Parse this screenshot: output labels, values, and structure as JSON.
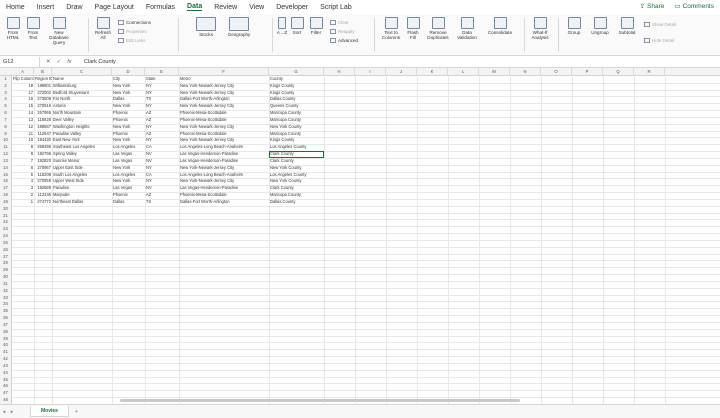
{
  "menu": {
    "tabs": [
      "Home",
      "Insert",
      "Draw",
      "Page Layout",
      "Formulas",
      "Data",
      "Review",
      "View",
      "Developer",
      "Script Lab"
    ],
    "active": "Data",
    "share_label": "Share",
    "comments_label": "Comments"
  },
  "ribbon": {
    "from_html": "From HTML",
    "from_text": "From Text",
    "new_db_query": "New Database Query",
    "refresh_all": "Refresh All",
    "connections": "Connections",
    "properties": "Properties",
    "edit_links": "Edit Links",
    "stocks": "Stocks",
    "geography": "Geography",
    "sort_az": "A→Z",
    "sort": "Sort",
    "filter": "Filter",
    "clear": "Clear",
    "reapply": "Reapply",
    "advanced": "Advanced",
    "text_to_columns": "Text to Columns",
    "flash_fill": "Flash Fill",
    "remove_duplicates": "Remove Duplicates",
    "data_validation": "Data Validation",
    "consolidate": "Consolidate",
    "what_if": "What-If Analysis",
    "group": "Group",
    "ungroup": "Ungroup",
    "subtotal": "Subtotal",
    "show_detail": "Show Detail",
    "hide_detail": "Hide Detail"
  },
  "formula_bar": {
    "name_box": "G12",
    "fx": "fx",
    "value": "Clark County"
  },
  "columns": [
    "A",
    "B",
    "C",
    "D",
    "E",
    "F",
    "G",
    "H",
    "I",
    "J",
    "K",
    "L",
    "M",
    "N",
    "O",
    "P",
    "Q",
    "R"
  ],
  "rows": [
    "1",
    "2",
    "3",
    "4",
    "5",
    "6",
    "7",
    "8",
    "9",
    "10",
    "11",
    "12",
    "13",
    "14",
    "15",
    "16",
    "17",
    "18",
    "19",
    "20",
    "21",
    "22",
    "23",
    "24",
    "25",
    "26",
    "27",
    "28",
    "29",
    "30",
    "31",
    "32",
    "33",
    "34",
    "35",
    "36",
    "37",
    "38",
    "39",
    "40",
    "41",
    "42",
    "43",
    "44",
    "45",
    "46",
    "47",
    "48"
  ],
  "headers": [
    "Flip Column",
    "Region ID",
    "Name",
    "City",
    "State",
    "Metro",
    "County"
  ],
  "table": [
    [
      "18",
      "199801",
      "Williamsburg",
      "New York",
      "NY",
      "New York-Newark-Jersey City",
      "Kings County"
    ],
    [
      "17",
      "272002",
      "Bedford Stuyvesant",
      "New York",
      "NY",
      "New York-Newark-Jersey City",
      "Kings County"
    ],
    [
      "16",
      "273608",
      "Far North",
      "Dallas",
      "TX",
      "Dallas-Fort Worth-Arlington",
      "Dallas County"
    ],
    [
      "15",
      "270916",
      "Astoria",
      "New York",
      "NY",
      "New York-Newark-Jersey City",
      "Queens County"
    ],
    [
      "14",
      "267955",
      "North Mountain",
      "Phoenix",
      "AZ",
      "Phoenix-Mesa-Scottsdale",
      "Maricopa County"
    ],
    [
      "13",
      "115828",
      "Deer Valley",
      "Phoenix",
      "AZ",
      "Phoenix-Mesa-Scottsdale",
      "Maricopa County"
    ],
    [
      "12",
      "198687",
      "Washington Heights",
      "New York",
      "NY",
      "New York-Newark-Jersey City",
      "New York County"
    ],
    [
      "11",
      "112547",
      "Paradise Valley",
      "Phoenix",
      "AZ",
      "Phoenix-Mesa-Scottsdale",
      "Maricopa County"
    ],
    [
      "10",
      "194430",
      "East New York",
      "New York",
      "NY",
      "New York-Newark-Jersey City",
      "Kings County"
    ],
    [
      "9",
      "268496",
      "Southeast Los Angeles",
      "Los Angeles",
      "CA",
      "Los Angeles-Long Beach-Anaheim",
      "Los Angeles County"
    ],
    [
      "8",
      "192796",
      "Spring Valley",
      "Las Vegas",
      "NV",
      "Las Vegas-Henderson-Paradise",
      "Clark County"
    ],
    [
      "7",
      "192820",
      "Sunrise Manor",
      "Las Vegas",
      "NV",
      "Las Vegas-Henderson-Paradise",
      "Clark County"
    ],
    [
      "6",
      "270957",
      "Upper East Side",
      "New York",
      "NY",
      "New York-Newark-Jersey City",
      "New York County"
    ],
    [
      "5",
      "118208",
      "South Los Angeles",
      "Los Angeles",
      "CA",
      "Los Angeles-Long Beach-Anaheim",
      "Los Angeles County"
    ],
    [
      "4",
      "270959",
      "Upper West Side",
      "New York",
      "NY",
      "New York-Newark-Jersey City",
      "New York County"
    ],
    [
      "3",
      "192689",
      "Paradise",
      "Las Vegas",
      "NV",
      "Las Vegas-Henderson-Paradise",
      "Clark County"
    ],
    [
      "2",
      "112345",
      "Maryvale",
      "Phoenix",
      "AZ",
      "Phoenix-Mesa-Scottsdale",
      "Maricopa County"
    ],
    [
      "1",
      "274772",
      "Northeast Dallas",
      "Dallas",
      "TX",
      "Dallas-Fort Worth-Arlington",
      "Dallas County"
    ]
  ],
  "sheet": {
    "name": "Movies",
    "add": "+",
    "prev": "◂",
    "next": "▸"
  }
}
